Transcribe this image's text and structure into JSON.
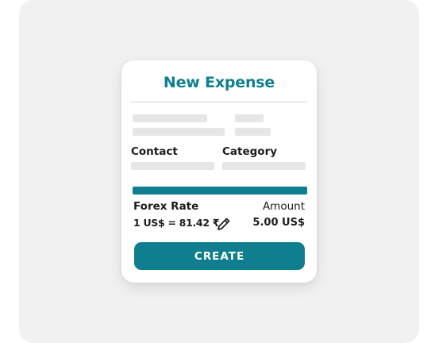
{
  "form": {
    "title": "New Expense",
    "contact_label": "Contact",
    "category_label": "Category",
    "forex_label": "Forex Rate",
    "forex_value": "1 US$ = 81.42 ₹",
    "amount_label": "Amount",
    "amount_value": "5.00 US$",
    "create_label": "CREATE"
  },
  "colors": {
    "accent": "#0f7f8f",
    "placeholder": "#e6e6e6",
    "background": "#f1f1f1"
  },
  "icons": {
    "edit": "pencil-icon"
  }
}
